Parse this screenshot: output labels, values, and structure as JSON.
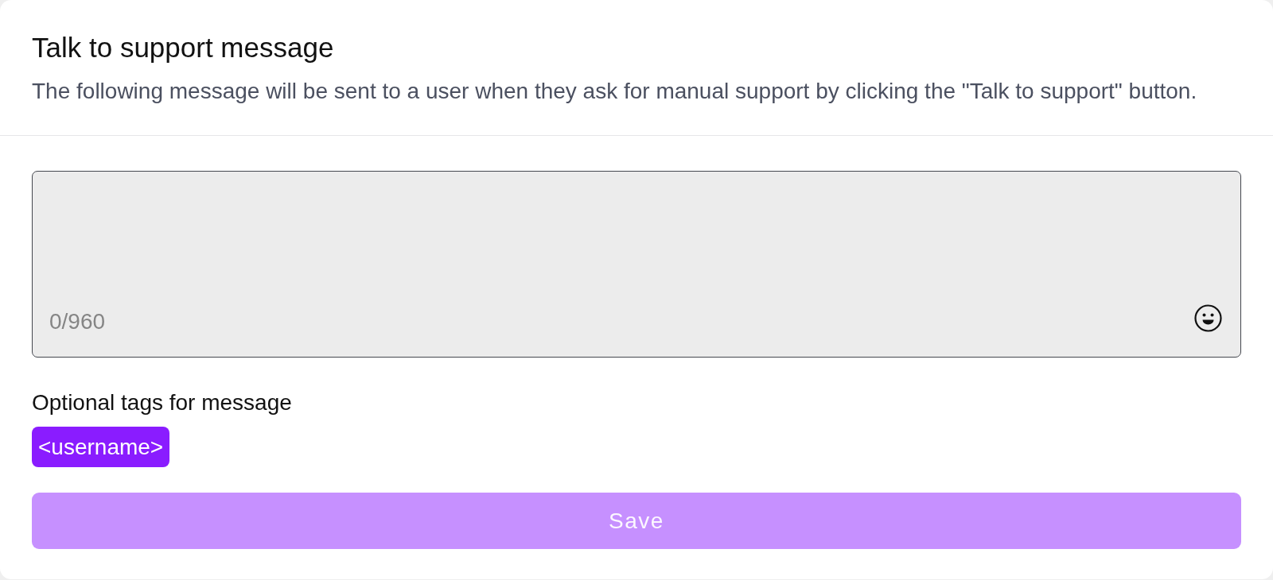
{
  "header": {
    "title": "Talk to support message",
    "description": "The following message will be sent to a user when they ask for manual support by clicking the \"Talk to support\" button."
  },
  "message_field": {
    "counter": "0/960"
  },
  "tags": {
    "label": "Optional tags for message",
    "items": [
      {
        "label": "<username>"
      }
    ]
  },
  "save_button": {
    "label": "Save",
    "disabled": true
  }
}
